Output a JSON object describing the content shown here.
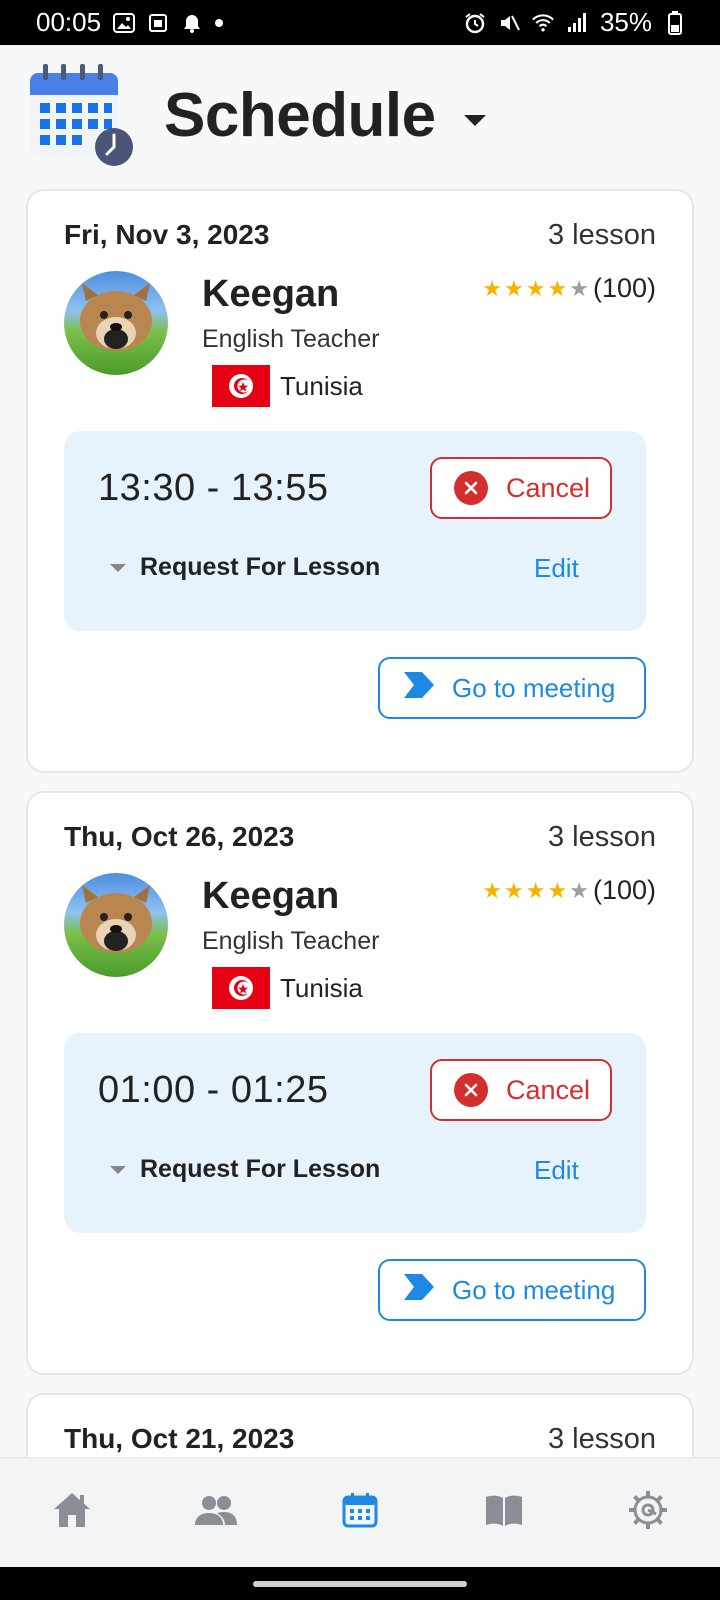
{
  "status_bar": {
    "time": "00:05",
    "battery": "35%"
  },
  "header": {
    "title": "Schedule"
  },
  "cards": [
    {
      "date": "Fri, Nov 3, 2023",
      "lesson_count": "3 lesson",
      "tutor": {
        "name": "Keegan",
        "role": "English Teacher",
        "country": "Tunisia",
        "rating_stars": 4,
        "rating_max": 5,
        "rating_count": "(100)"
      },
      "lesson": {
        "time": "13:30 - 13:55",
        "cancel_label": "Cancel",
        "request_label": "Request For Lesson",
        "edit_label": "Edit"
      },
      "meeting_label": "Go to meeting"
    },
    {
      "date": "Thu, Oct 26, 2023",
      "lesson_count": "3 lesson",
      "tutor": {
        "name": "Keegan",
        "role": "English Teacher",
        "country": "Tunisia",
        "rating_stars": 4,
        "rating_max": 5,
        "rating_count": "(100)"
      },
      "lesson": {
        "time": "01:00 - 01:25",
        "cancel_label": "Cancel",
        "request_label": "Request For Lesson",
        "edit_label": "Edit"
      },
      "meeting_label": "Go to meeting"
    }
  ],
  "partial_card": {
    "date": "Thu, Oct 21, 2023",
    "lesson_count": "3 lesson"
  },
  "bottom_nav": {
    "items": [
      {
        "icon": "home-icon",
        "active": false
      },
      {
        "icon": "people-icon",
        "active": false
      },
      {
        "icon": "calendar-icon",
        "active": true
      },
      {
        "icon": "book-icon",
        "active": false
      },
      {
        "icon": "settings-icon",
        "active": false
      }
    ]
  },
  "colors": {
    "accent": "#1e88e5",
    "danger": "#d32f2f",
    "lesson_bg": "#e6f3fc",
    "star": "#f5b400",
    "nav_inactive": "#8a8f96"
  }
}
